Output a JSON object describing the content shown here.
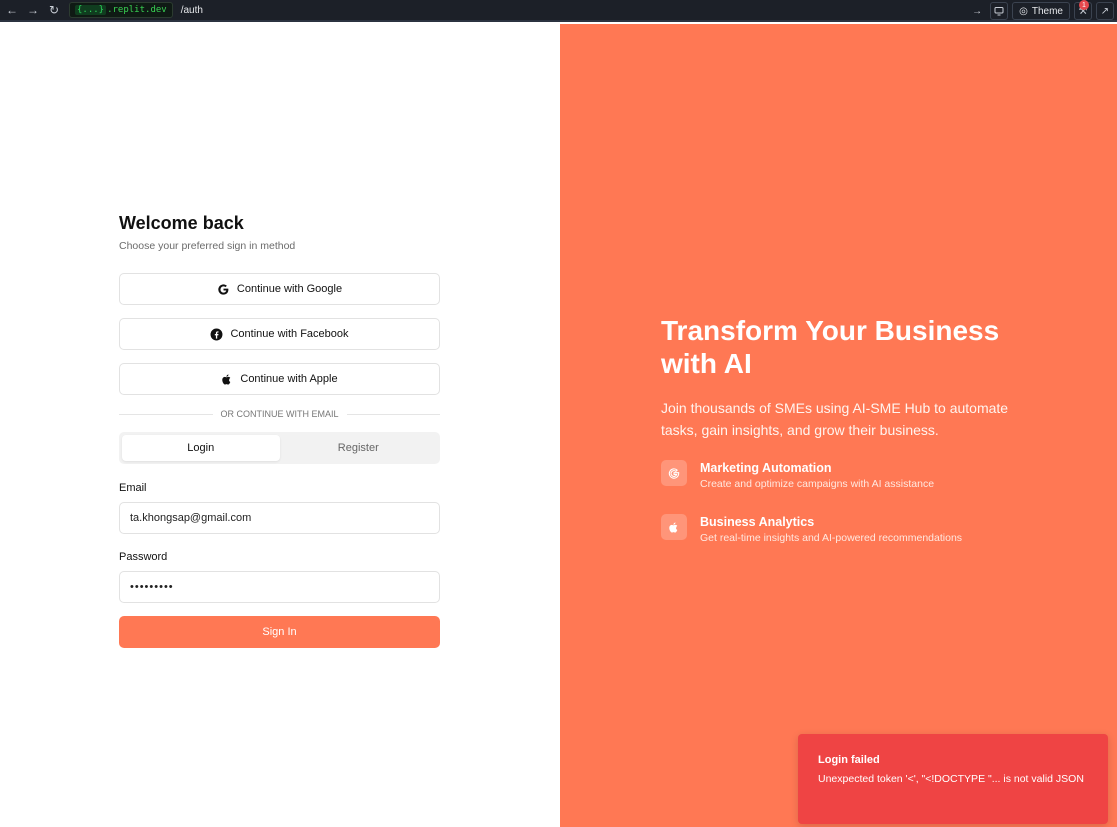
{
  "browser": {
    "domain_prefix": "{...}",
    "domain": ".replit.dev",
    "path": "/auth",
    "theme_label": "Theme",
    "badge_count": "1"
  },
  "auth": {
    "title": "Welcome back",
    "subtitle": "Choose your preferred sign in method",
    "google_label": "Continue with Google",
    "facebook_label": "Continue with Facebook",
    "apple_label": "Continue with Apple",
    "divider": "OR CONTINUE WITH EMAIL",
    "tabs": [
      {
        "label": "Login",
        "active": true
      },
      {
        "label": "Register",
        "active": false
      }
    ],
    "email_label": "Email",
    "email_value": "ta.khongsap@gmail.com",
    "password_label": "Password",
    "password_value": "•••••••••",
    "submit_label": "Sign In"
  },
  "hero": {
    "title": "Transform Your Business with AI",
    "subtitle": "Join thousands of SMEs using AI-SME Hub to automate tasks, gain insights, and grow their business.",
    "features": [
      {
        "title": "Marketing Automation",
        "desc": "Create and optimize campaigns with AI assistance",
        "icon": "google-icon"
      },
      {
        "title": "Business Analytics",
        "desc": "Get real-time insights and AI-powered recommendations",
        "icon": "apple-icon"
      }
    ]
  },
  "toast": {
    "title": "Login failed",
    "message": "Unexpected token '<', \"<!DOCTYPE \"... is not valid JSON"
  },
  "colors": {
    "accent": "#ff7854",
    "toast_bg": "#ef4444"
  }
}
